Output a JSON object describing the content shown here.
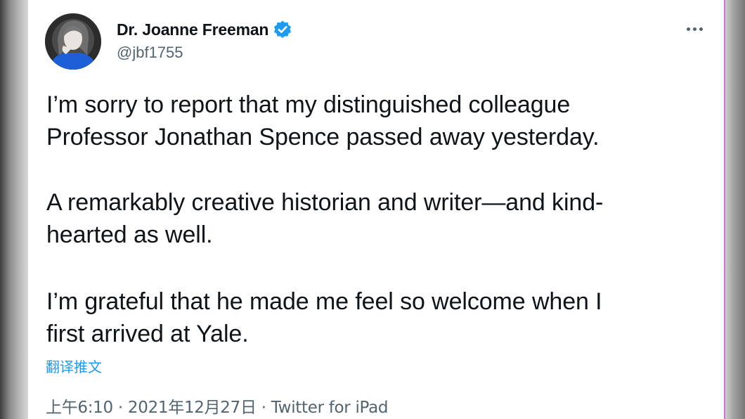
{
  "tweet": {
    "author": {
      "name": "Dr. Joanne Freeman",
      "handle": "@jbf1755",
      "verified": true
    },
    "paragraphs": [
      "I’m sorry to report that my distinguished colleague\nProfessor Jonathan Spence passed away yesterday.",
      "A remarkably creative historian and writer—and kind-\nhearted as well.",
      "I’m grateful that he made me feel so welcome when I\nfirst arrived at Yale."
    ],
    "translate_label": "翻译推文",
    "time": "上午6:10",
    "date": "2021年12月27日",
    "source": "Twitter for iPad",
    "separator": "·"
  },
  "colors": {
    "text": "#0f1419",
    "secondary": "#536471",
    "link": "#1d9bf0",
    "verified": "#1d9bf0"
  },
  "icons": {
    "verified": "verified-badge-icon",
    "more": "more-options-icon"
  }
}
